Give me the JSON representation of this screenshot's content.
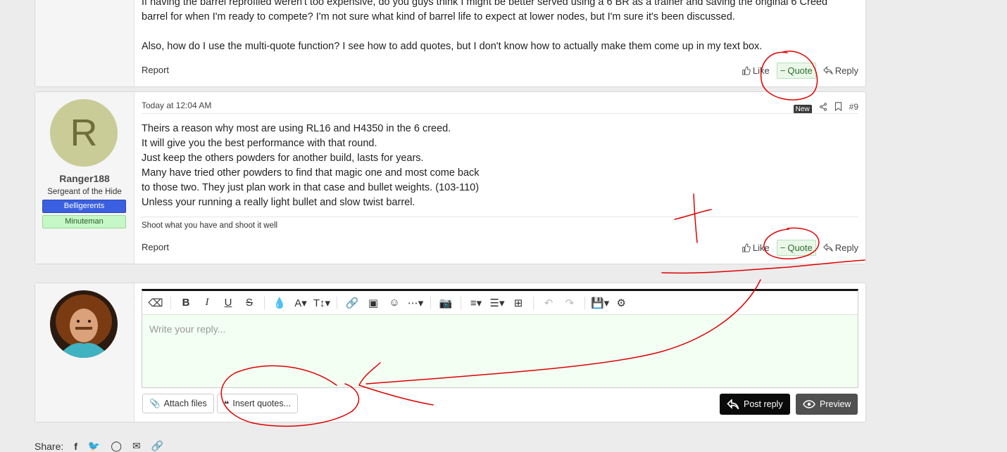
{
  "post8": {
    "line1": "If having the barrel reprofiled weren't too expensive, do you guys think I might be better served using a 6 BR as a trainer and saving the original 6 Creed",
    "line2": "barrel for when I'm ready to compete? I'm not sure what kind of barrel life to expect at lower nodes, but I'm sure it's been discussed.",
    "line3": "Also, how do I use the multi-quote function? I see how to add quotes, but I don't know how to actually make them come up in my text box.",
    "report": "Report",
    "like": "Like",
    "quote": "Quote",
    "reply": "Reply"
  },
  "post9": {
    "avatar_letter": "R",
    "username": "Ranger188",
    "user_title": "Sergeant of the Hide",
    "banners": [
      "Belligerents",
      "Minuteman"
    ],
    "timestamp": "Today at 12:04 AM",
    "new_badge": "New",
    "post_number": "#9",
    "lines": [
      "Theirs a reason why most are using RL16 and H4350 in the 6 creed.",
      "It will give you the best performance with that round.",
      "Just keep the others powders for another build, lasts for years.",
      "Many have tried other powders to find that magic one and most come back",
      "to those two. They just plan work in that case and bullet weights. (103-110)",
      "Unless your running a really light bullet and slow twist barrel."
    ],
    "signature": "Shoot what you have and shoot it well",
    "report": "Report",
    "like": "Like",
    "quote": "Quote",
    "reply": "Reply"
  },
  "reply_box": {
    "placeholder": "Write your reply...",
    "attach_files": "Attach files",
    "insert_quotes": "Insert quotes...",
    "post_reply": "Post reply",
    "preview": "Preview"
  },
  "share": {
    "label": "Share:"
  },
  "colors": {
    "editor_bg": "#f3fff3",
    "banner_blue": "#3a5fe0",
    "banner_green": "#c6f7c6",
    "annotation_red": "#e00000"
  }
}
